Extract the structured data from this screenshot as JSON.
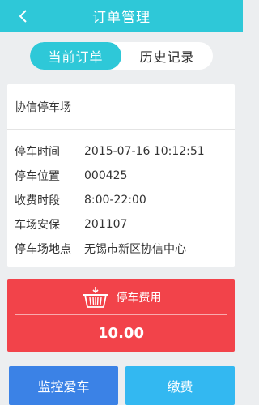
{
  "header": {
    "title": "订单管理",
    "back_icon": "chevron-left-icon"
  },
  "tabs": [
    {
      "label": "当前订单",
      "active": true
    },
    {
      "label": "历史记录",
      "active": false
    }
  ],
  "order": {
    "lot_name": "协信停车场",
    "rows": [
      {
        "label": "停车时间",
        "value": "2015-07-16 10:12:51"
      },
      {
        "label": "停车位置",
        "value": "000425"
      },
      {
        "label": "收费时段",
        "value": "8:00-22:00"
      },
      {
        "label": "车场安保",
        "value": "201107"
      },
      {
        "label": "停车场地点",
        "value": "无锡市新区协信中心"
      }
    ]
  },
  "fee": {
    "icon": "shopping-basket-icon",
    "label": "停车费用",
    "amount": "10.00"
  },
  "actions": {
    "monitor_label": "监控爱车",
    "pay_label": "缴费"
  },
  "colors": {
    "accent": "#2ec8d8",
    "fee_red": "#f2434a",
    "monitor_blue": "#3b82e6",
    "pay_blue": "#33b8f1"
  }
}
